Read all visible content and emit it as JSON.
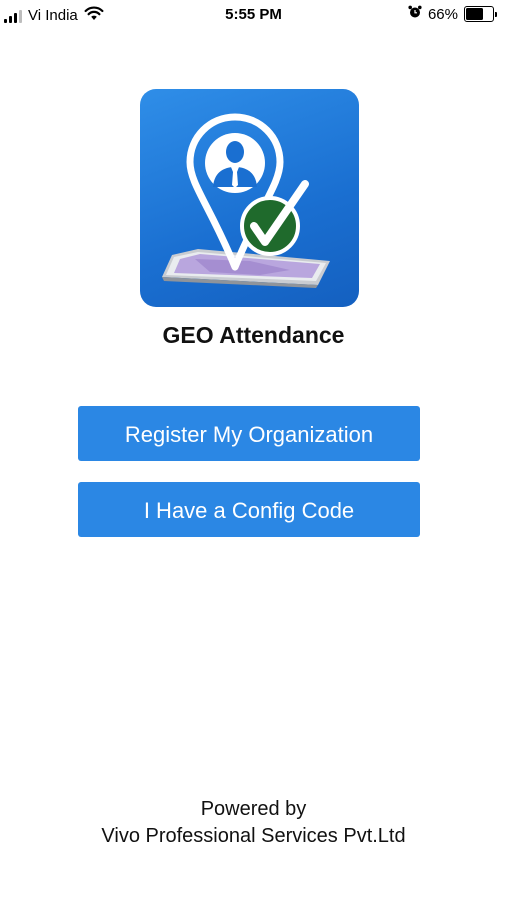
{
  "status_bar": {
    "carrier": "Vi India",
    "time": "5:55 PM",
    "battery_percent": "66%",
    "battery_level": 0.66,
    "icons": [
      "signal-icon",
      "wifi-icon",
      "alarm-icon",
      "battery-icon"
    ]
  },
  "app": {
    "title": "GEO Attendance",
    "logo": "geo-attendance-logo"
  },
  "buttons": {
    "register_label": "Register My Organization",
    "config_label": "I Have a Config Code"
  },
  "footer": {
    "powered_by": "Powered by",
    "company": "Vivo Professional Services Pvt.Ltd"
  },
  "colors": {
    "button_blue": "#2b87e4",
    "icon_blue": "#1a6fd1",
    "check_green": "#1f6a2c"
  }
}
